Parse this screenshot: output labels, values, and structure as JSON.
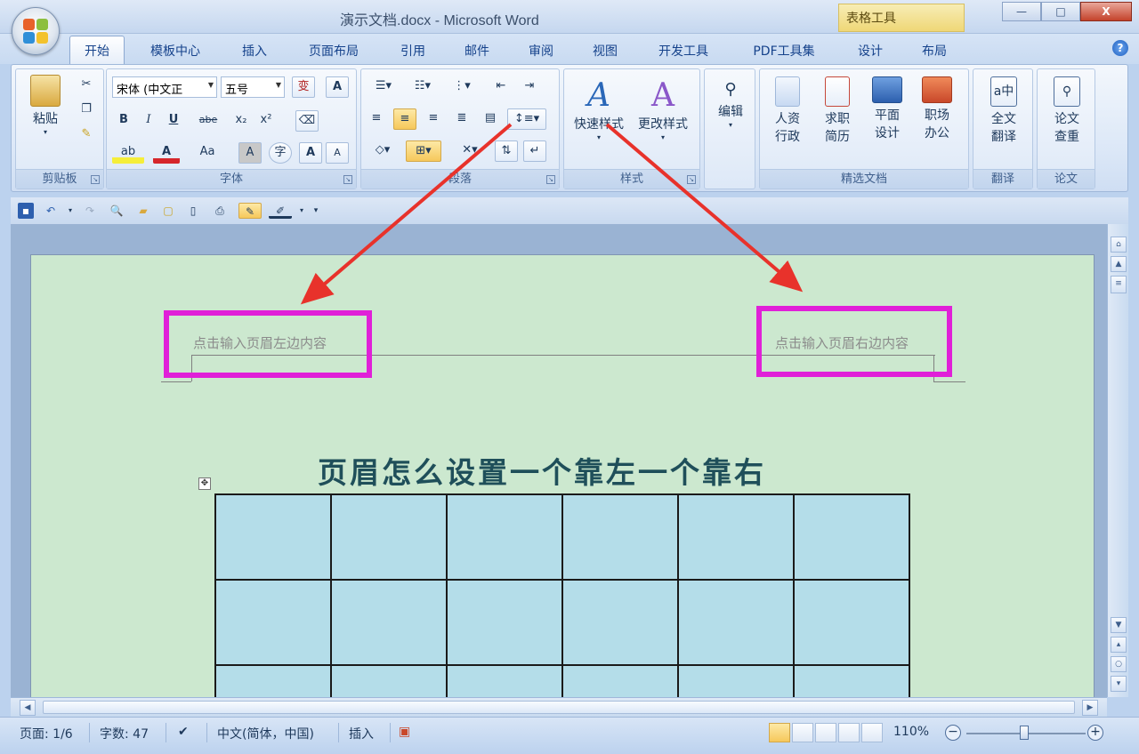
{
  "window": {
    "title": "演示文档.docx - Microsoft Word",
    "context_tab_title": "表格工具",
    "controls": {
      "minimize": "—",
      "maximize": "□",
      "close": "X"
    }
  },
  "tabs": [
    {
      "label": "开始",
      "active": true
    },
    {
      "label": "模板中心"
    },
    {
      "label": "插入"
    },
    {
      "label": "页面布局"
    },
    {
      "label": "引用"
    },
    {
      "label": "邮件"
    },
    {
      "label": "审阅"
    },
    {
      "label": "视图"
    },
    {
      "label": "开发工具"
    },
    {
      "label": "PDF工具集"
    },
    {
      "label": "设计"
    },
    {
      "label": "布局"
    }
  ],
  "ribbon": {
    "clipboard": {
      "label": "剪贴板",
      "paste": "粘贴"
    },
    "font": {
      "label": "字体",
      "font_name": "宋体 (中文正",
      "font_size": "五号",
      "bold": "B",
      "italic": "I",
      "underline": "U",
      "strike": "abe",
      "subscript": "x₂",
      "superscript": "x²",
      "grow": "A",
      "shrink": "A"
    },
    "paragraph": {
      "label": "段落"
    },
    "styles": {
      "label": "样式",
      "quick_styles": "快速样式",
      "change_styles": "更改样式"
    },
    "editing": {
      "label": "编辑"
    },
    "selected_docs": {
      "label": "精选文档",
      "items": [
        {
          "line1": "人资",
          "line2": "行政"
        },
        {
          "line1": "求职",
          "line2": "简历"
        },
        {
          "line1": "平面",
          "line2": "设计"
        },
        {
          "line1": "职场",
          "line2": "办公"
        }
      ]
    },
    "translate": {
      "label": "翻译",
      "line1": "全文",
      "line2": "翻译"
    },
    "paper": {
      "label": "论文",
      "line1": "论文",
      "line2": "查重"
    }
  },
  "document": {
    "header_left": "点击输入页眉左边内容",
    "header_right": "点击输入页眉右边内容",
    "heading": "页眉怎么设置一个靠左一个靠右",
    "table": {
      "rows": 3,
      "cols": 6
    }
  },
  "status": {
    "page": "页面: 1/6",
    "words": "字数: 47",
    "language": "中文(简体，中国)",
    "mode": "插入",
    "zoom": "110%"
  },
  "colors": {
    "annotation_box": "#e020d8",
    "annotation_arrow": "#e8322b",
    "page_background": "#cce8cf",
    "table_cell": "#b4dde9"
  }
}
